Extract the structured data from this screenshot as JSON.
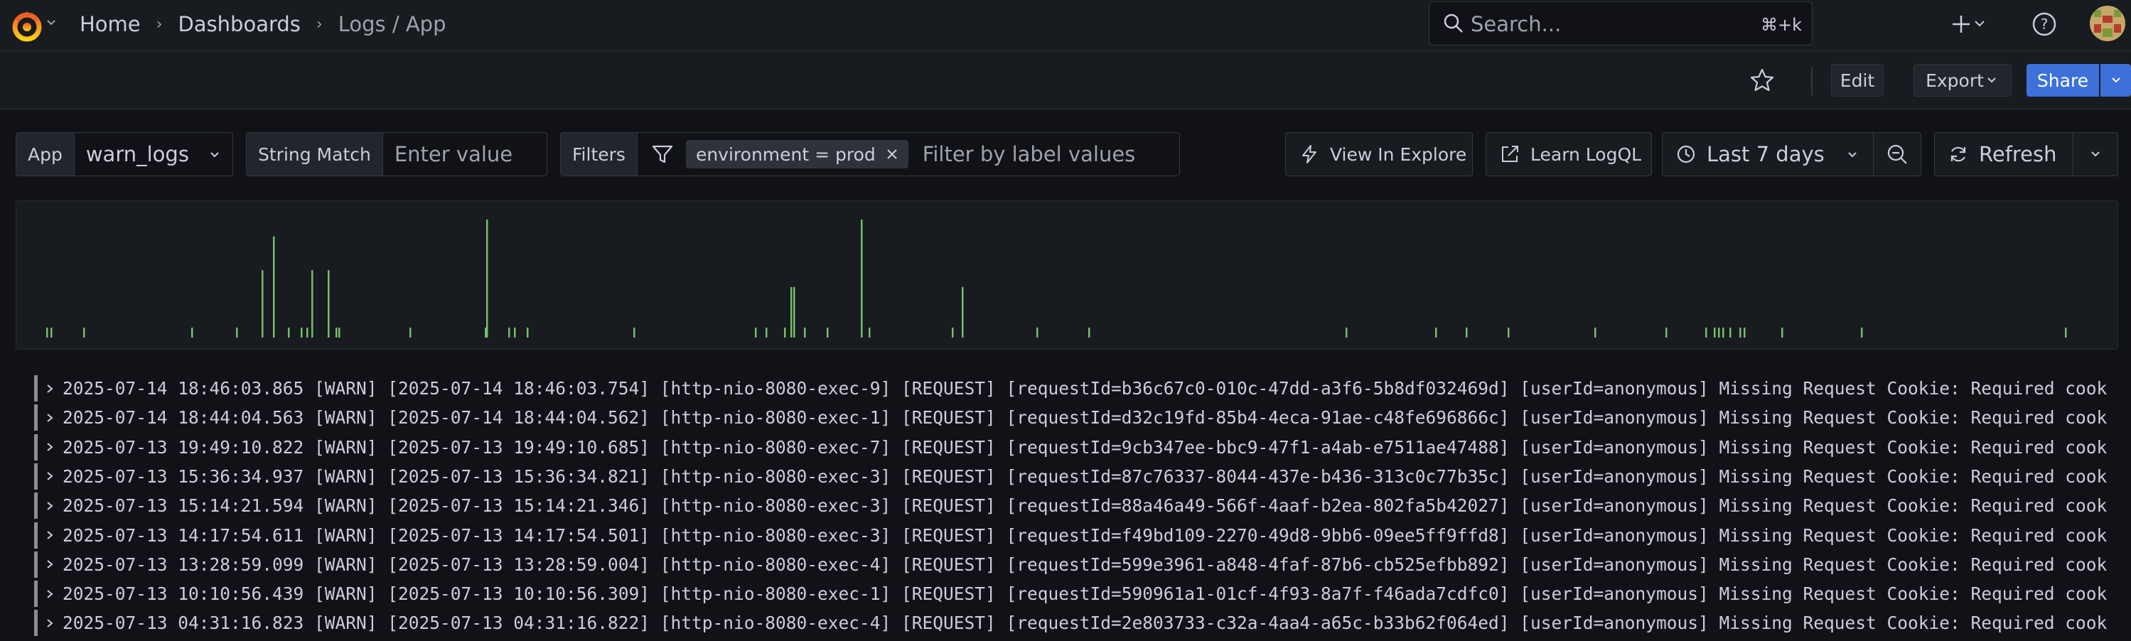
{
  "nav": {
    "breadcrumbs": [
      "Home",
      "Dashboards",
      "Logs / App"
    ],
    "search_placeholder": "Search...",
    "search_shortcut": "⌘+k"
  },
  "toolbar": {
    "edit_label": "Edit",
    "export_label": "Export",
    "share_label": "Share"
  },
  "variables": {
    "app": {
      "label": "App",
      "value": "warn_logs"
    },
    "string_match": {
      "label": "String Match",
      "placeholder": "Enter value"
    },
    "filters": {
      "label": "Filters",
      "chip": "environment = prod",
      "placeholder": "Filter by label values"
    }
  },
  "actions": {
    "view_in_explore": "View In Explore",
    "learn_logql": "Learn LogQL",
    "time_range": "Last 7 days",
    "refresh": "Refresh"
  },
  "colors": {
    "accent_blue": "#3d71d9",
    "histogram_bar": "#73bf69",
    "log_level_bar": "#8e8e8e"
  },
  "logs": [
    "2025-07-14 18:46:03.865 [WARN] [2025-07-14 18:46:03.754] [http-nio-8080-exec-9] [REQUEST] [requestId=b36c67c0-010c-47dd-a3f6-5b8df032469d] [userId=anonymous] Missing Request Cookie: Required cooki",
    "2025-07-14 18:44:04.563 [WARN] [2025-07-14 18:44:04.562] [http-nio-8080-exec-1] [REQUEST] [requestId=d32c19fd-85b4-4eca-91ae-c48fe696866c] [userId=anonymous] Missing Request Cookie: Required cooki",
    "2025-07-13 19:49:10.822 [WARN] [2025-07-13 19:49:10.685] [http-nio-8080-exec-7] [REQUEST] [requestId=9cb347ee-bbc9-47f1-a4ab-e7511ae47488] [userId=anonymous] Missing Request Cookie: Required cooki",
    "2025-07-13 15:36:34.937 [WARN] [2025-07-13 15:36:34.821] [http-nio-8080-exec-3] [REQUEST] [requestId=87c76337-8044-437e-b436-313c0c77b35c] [userId=anonymous] Missing Request Cookie: Required cooki",
    "2025-07-13 15:14:21.594 [WARN] [2025-07-13 15:14:21.346] [http-nio-8080-exec-3] [REQUEST] [requestId=88a46a49-566f-4aaf-b2ea-802fa5b42027] [userId=anonymous] Missing Request Cookie: Required cooki",
    "2025-07-13 14:17:54.611 [WARN] [2025-07-13 14:17:54.501] [http-nio-8080-exec-3] [REQUEST] [requestId=f49bd109-2270-49d8-9bb6-09ee5ff9ffd8] [userId=anonymous] Missing Request Cookie: Required cooki",
    "2025-07-13 13:28:59.099 [WARN] [2025-07-13 13:28:59.004] [http-nio-8080-exec-4] [REQUEST] [requestId=599e3961-a848-4faf-87b6-cb525efbb892] [userId=anonymous] Missing Request Cookie: Required cooki",
    "2025-07-13 10:10:56.439 [WARN] [2025-07-13 10:10:56.309] [http-nio-8080-exec-1] [REQUEST] [requestId=590961a1-01cf-4f93-8a7f-f46ada7cdfc0] [userId=anonymous] Missing Request Cookie: Required cooki",
    "2025-07-13 04:31:16.823 [WARN] [2025-07-13 04:31:16.822] [http-nio-8080-exec-4] [REQUEST] [requestId=2e803733-c32a-4aa4-a65c-b33b62f064ed] [userId=anonymous] Missing Request Cookie: Required cooki"
  ],
  "histogram_counts": [
    1,
    1,
    1,
    1,
    1,
    4,
    6,
    1,
    1,
    1,
    4,
    4,
    1,
    1,
    1,
    1,
    7,
    1,
    1,
    1,
    1,
    1,
    1,
    1,
    3,
    3,
    1,
    1,
    7,
    1,
    1,
    3,
    1,
    1,
    1,
    1,
    1,
    1,
    1,
    1,
    1,
    1,
    1,
    1,
    1,
    1,
    1,
    1,
    1,
    1
  ]
}
